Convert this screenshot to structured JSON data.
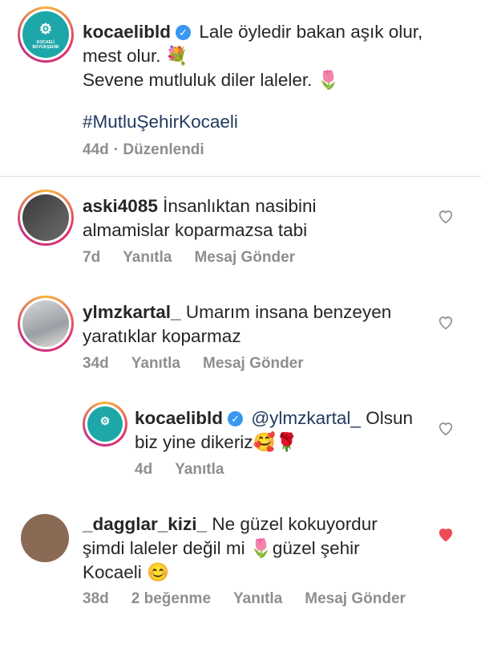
{
  "post": {
    "username": "kocaelibld",
    "caption_line1": "Lale öyledir bakan aşık olur,",
    "caption_line2": "mest olur. 💐",
    "caption_line3": "Sevene mutluluk diler laleler. 🌷",
    "hashtag": "#MutluŞehirKocaeli",
    "time": "44d",
    "edited": "· Düzenlendi",
    "logo_line1": "KOCAELİ",
    "logo_line2": "BÜYÜKŞEHİR"
  },
  "comments": [
    {
      "username": "aski4085",
      "line1": "İnsanlıktan nasibini",
      "line2": "almamislar koparmazsa tabi",
      "time": "7d",
      "reply": "Yanıtla",
      "message": "Mesaj Gönder",
      "liked": false
    },
    {
      "username": "ylmzkartal_",
      "line1": "Umarım insana benzeyen",
      "line2": "yaratıklar koparmaz",
      "time": "34d",
      "reply": "Yanıtla",
      "message": "Mesaj Gönder",
      "liked": false
    },
    {
      "username": "kocaelibld",
      "mention": "@ylmzkartal_",
      "line1": "Olsun",
      "line2": "biz yine dikeriz🥰🌹",
      "time": "4d",
      "reply": "Yanıtla",
      "liked": false
    },
    {
      "username": "_dagglar_kizi_",
      "line1": "Ne güzel kokuyordur",
      "line2": "şimdi laleler değil mi 🌷güzel şehir",
      "line3": "Kocaeli 😊",
      "time": "38d",
      "likes": "2 beğenme",
      "reply": "Yanıtla",
      "message": "Mesaj Gönder",
      "liked": true
    }
  ],
  "colors": {
    "like_red": "#ed4956",
    "verified_blue": "#3897f0",
    "meta_gray": "#8e8e8e",
    "link_navy": "#1e3a5f"
  }
}
